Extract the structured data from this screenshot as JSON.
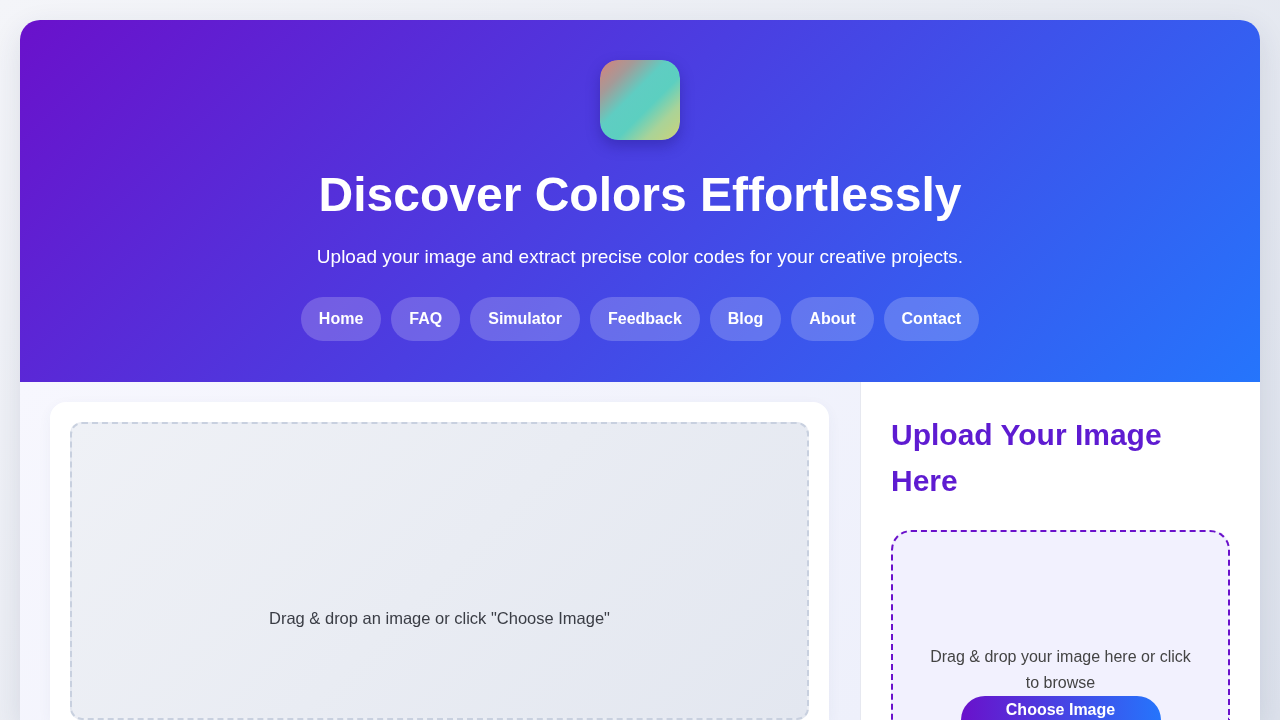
{
  "header": {
    "title": "Discover Colors Effortlessly",
    "subtitle": "Upload your image and extract precise color codes for your creative projects.",
    "nav": [
      "Home",
      "FAQ",
      "Simulator",
      "Feedback",
      "Blog",
      "About",
      "Contact"
    ]
  },
  "preview": {
    "hint": "Drag & drop an image or click \"Choose Image\""
  },
  "upload": {
    "heading": "Upload Your Image Here",
    "hint": "Drag & drop your image here or click to browse",
    "button": "Choose Image"
  }
}
